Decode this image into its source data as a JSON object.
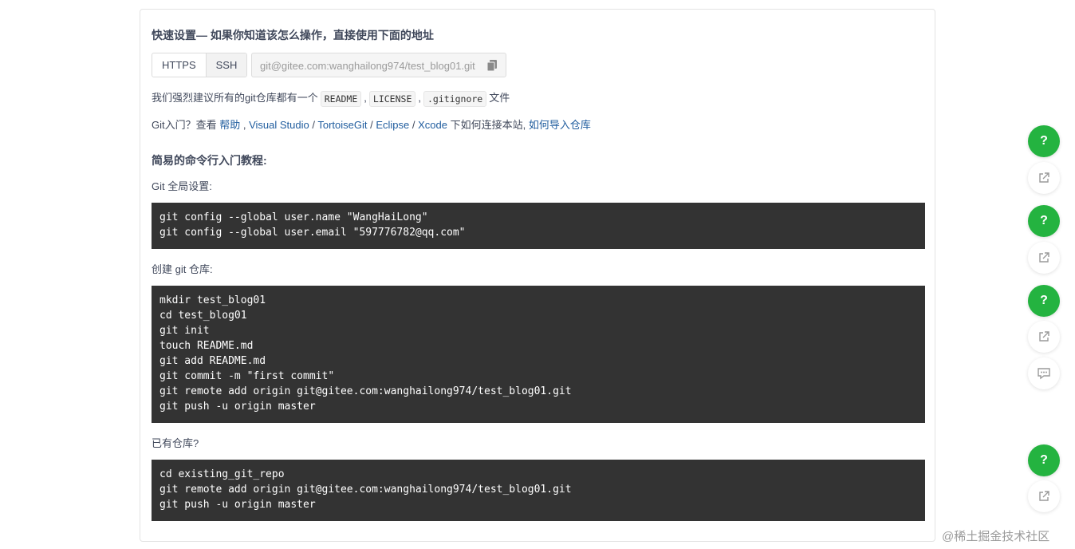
{
  "quick_setup": {
    "title": "快速设置— 如果你知道该怎么操作，直接使用下面的地址",
    "protocols": [
      "HTTPS",
      "SSH"
    ],
    "selected_protocol": "SSH",
    "repo_url": "git@gitee.com:wanghailong974/test_blog01.git"
  },
  "recommend": {
    "prefix": "我们强烈建议所有的git仓库都有一个",
    "files": [
      "README",
      "LICENSE",
      ".gitignore"
    ],
    "separator": ",",
    "suffix": "文件"
  },
  "help_line": {
    "prefix": "Git入门？查看 ",
    "help_link": "帮助",
    "sep1": " , ",
    "visual_studio": "Visual Studio",
    "sep2": " / ",
    "tortoisegit": "TortoiseGit",
    "sep3": " / ",
    "eclipse": "Eclipse",
    "sep4": " / ",
    "xcode": "Xcode",
    "middle": " 下如何连接本站, ",
    "import_link": "如何导入仓库"
  },
  "tutorial": {
    "title": "简易的命令行入门教程:",
    "global_label": "Git 全局设置:",
    "global_code": "git config --global user.name \"WangHaiLong\"\ngit config --global user.email \"597776782@qq.com\"",
    "create_label": "创建 git 仓库:",
    "create_code": "mkdir test_blog01\ncd test_blog01\ngit init\ntouch README.md\ngit add README.md\ngit commit -m \"first commit\"\ngit remote add origin git@gitee.com:wanghailong974/test_blog01.git\ngit push -u origin master",
    "existing_label": "已有仓库?",
    "existing_code": "cd existing_git_repo\ngit remote add origin git@gitee.com:wanghailong974/test_blog01.git\ngit push -u origin master"
  },
  "floating": {
    "help_glyph": "?",
    "accent": "#24b340"
  },
  "watermark": "@稀土掘金技术社区"
}
